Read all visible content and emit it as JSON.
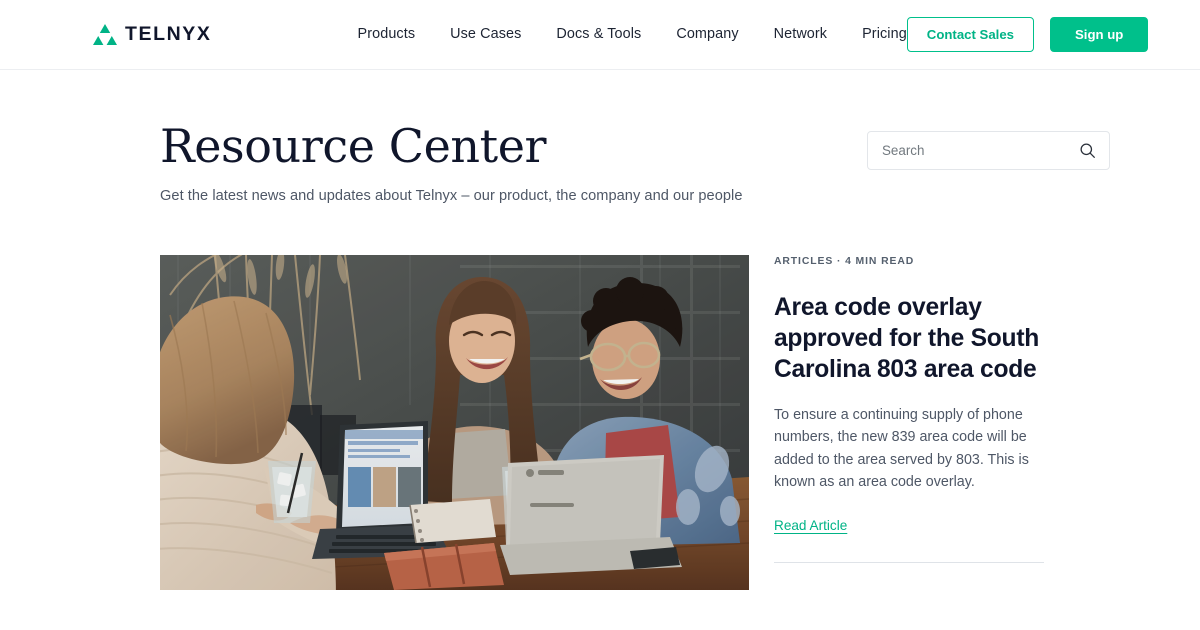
{
  "brand": {
    "name": "TELNYX",
    "logo_icon": "telnyx-triangles-logo",
    "accent_color": "#00c08b",
    "text_color": "#10162b"
  },
  "header": {
    "nav": [
      {
        "label": "Products"
      },
      {
        "label": "Use Cases"
      },
      {
        "label": "Docs & Tools"
      },
      {
        "label": "Company"
      },
      {
        "label": "Network"
      },
      {
        "label": "Pricing"
      }
    ],
    "contact_sales_label": "Contact Sales",
    "sign_up_label": "Sign up"
  },
  "hero": {
    "title": "Resource Center",
    "subtitle": "Get the latest news and updates about Telnyx – our product, the company and our people"
  },
  "search": {
    "placeholder": "Search",
    "value": "",
    "icon": "search-icon"
  },
  "featured_article": {
    "meta": "ARTICLES · 4 MIN READ",
    "title": "Area code overlay approved for the South Carolina 803 area code",
    "description": "To ensure a continuing supply of phone numbers, the new 839 area code will be added to the area served by 803. This is known as an area code overlay.",
    "link_label": "Read Article",
    "image_alt": "Three people laughing around a wooden table with laptops"
  }
}
